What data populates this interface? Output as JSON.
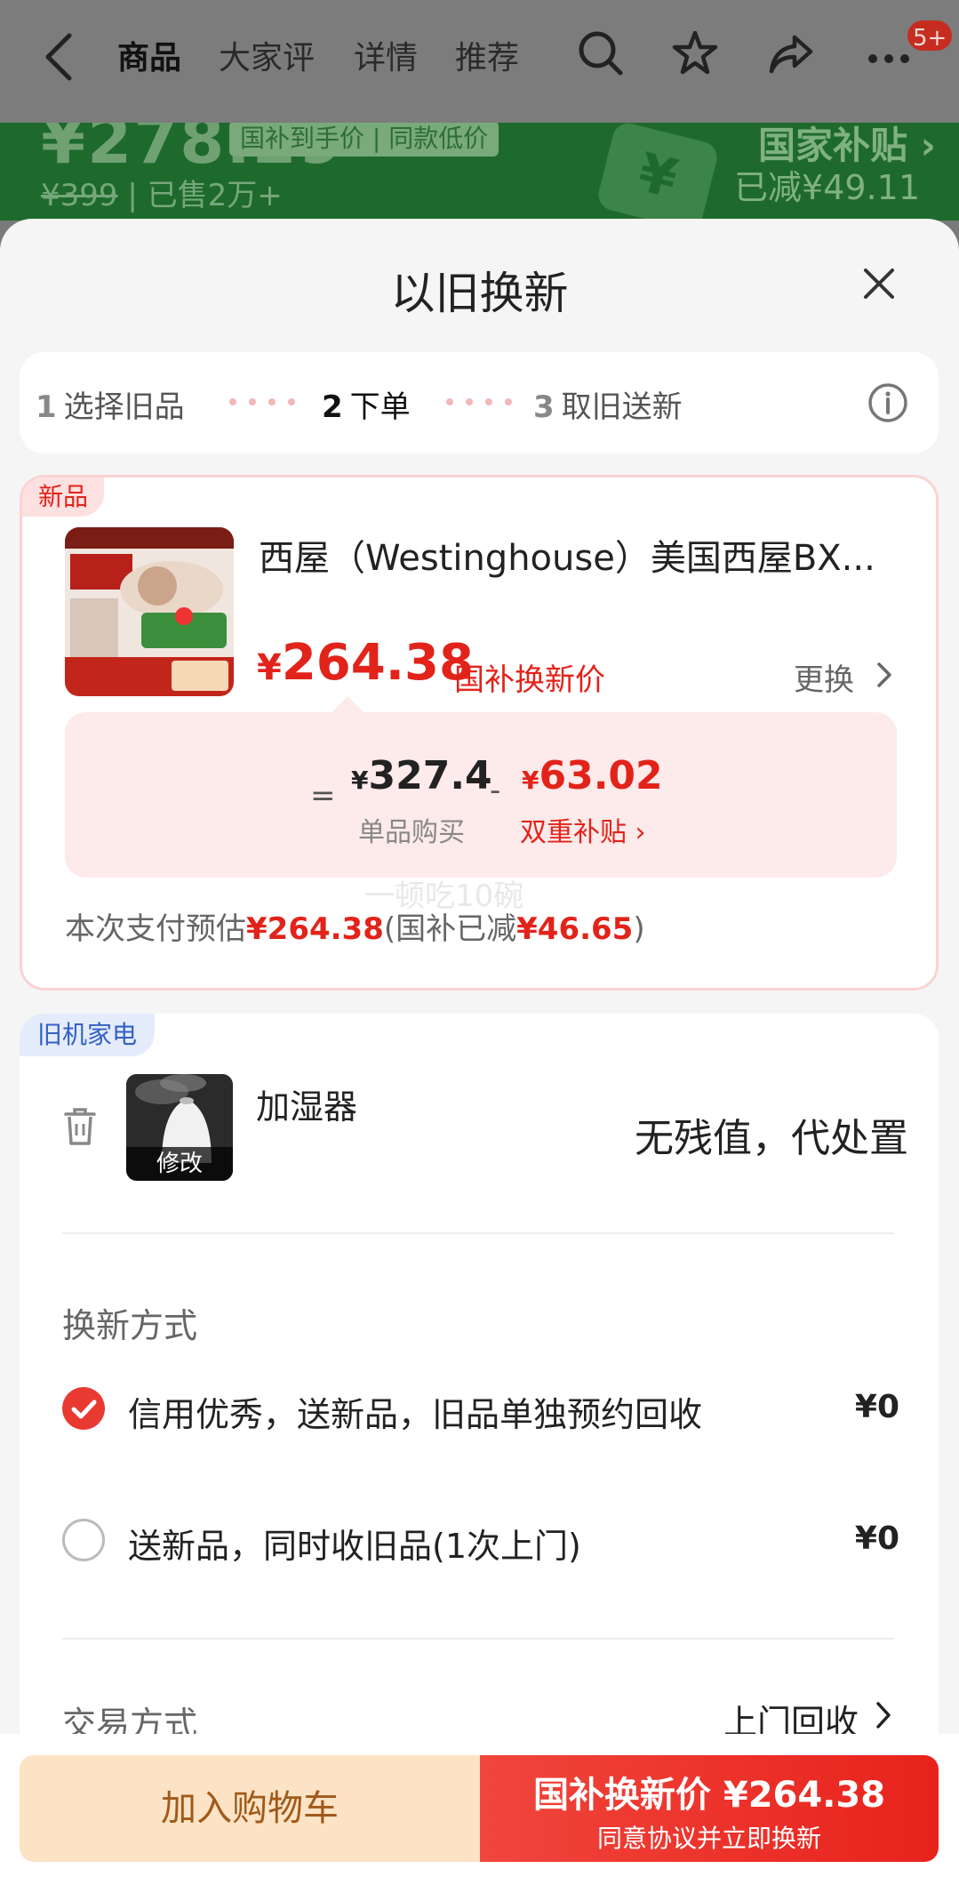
{
  "nav": {
    "tabs": [
      "商品",
      "大家评",
      "详情",
      "推荐"
    ],
    "badge": "5+"
  },
  "bg_banner": {
    "price_partial": "¥278.29",
    "tag": "国补到手价 | 同款低价",
    "original_price": "¥399",
    "sold": "已售2万+",
    "subsidy_link": "国家补贴",
    "reduced": "已减¥49.11"
  },
  "sheet": {
    "title": "以旧换新",
    "steps": [
      {
        "num": "1",
        "label": "选择旧品"
      },
      {
        "num": "2",
        "label": "下单"
      },
      {
        "num": "3",
        "label": "取旧送新"
      }
    ]
  },
  "new_item": {
    "tag": "新品",
    "name": "西屋（Westinghouse）美国西屋BX...",
    "price_symbol": "¥",
    "price": "264.38",
    "price_label": "国补换新价",
    "change_label": "更换",
    "calc": {
      "equals": "=",
      "single_price_symbol": "¥",
      "single_price": "327.4",
      "single_label": "单品购买",
      "minus": "-",
      "subsidy_symbol": "¥",
      "subsidy": "63.02",
      "subsidy_label": "双重补贴 ›"
    },
    "pay_note_prefix": "本次支付预估",
    "pay_amount": "¥264.38",
    "pay_note_mid": "(国补已减",
    "pay_reduced": "¥46.65",
    "pay_note_suffix": ")",
    "watermark": "一顿吃10碗"
  },
  "old_item": {
    "tag": "旧机家电",
    "name": "加湿器",
    "edit_label": "修改",
    "value": "无残值，代处置",
    "method_title": "换新方式",
    "options": [
      {
        "label": "信用优秀，送新品，旧品单独预约回收",
        "price": "¥0",
        "selected": true
      },
      {
        "label": "送新品，同时收旧品(1次上门)",
        "price": "¥0",
        "selected": false
      }
    ],
    "trade_title": "交易方式",
    "trade_value": "上门回收"
  },
  "bottom": {
    "cart_label": "加入购物车",
    "buy_label": "国补换新价 ¥264.38",
    "buy_sub": "同意协议并立即换新"
  },
  "colors": {
    "accent_red": "#e2231a",
    "subsidy_green": "#1e6a2c",
    "old_tag_blue": "#3360c4"
  }
}
